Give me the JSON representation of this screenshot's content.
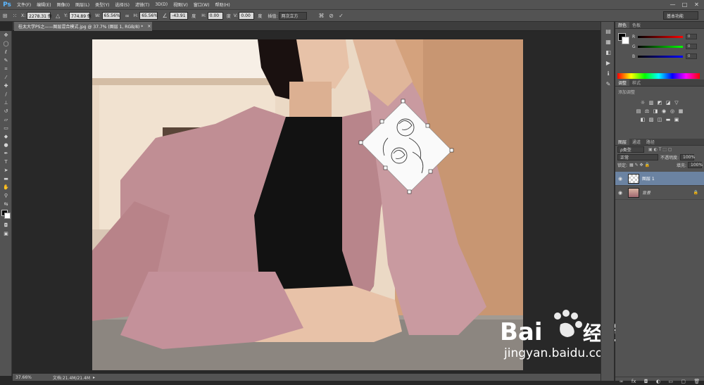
{
  "app": {
    "logo": "Ps"
  },
  "menu": [
    "文件(F)",
    "编辑(E)",
    "图像(I)",
    "图层(L)",
    "类型(Y)",
    "选择(S)",
    "滤镜(T)",
    "3D(D)",
    "视图(V)",
    "窗口(W)",
    "帮助(H)"
  ],
  "window_controls": [
    "—",
    "□",
    "✕"
  ],
  "options": {
    "x_label": "X:",
    "x_value": "2278.31 像",
    "y_label": "Y:",
    "y_value": "774.89 像",
    "w_label": "W:",
    "w_value": "65.56%",
    "h_label": "H:",
    "h_value": "65.56%",
    "angle_value": "-43.91",
    "angle_unit": "度",
    "hskew_label": "H:",
    "hskew_value": "0.00",
    "vskew_label": "V:",
    "vskew_value": "0.00",
    "skew_unit": "度",
    "interp_label": "插值:",
    "interp_value": "两次立方",
    "workspace": "基本功能"
  },
  "document": {
    "tab_title": "桂太大学PS之——图层混合模式.jpg @ 37.7% (图层 1, RGB/8) *",
    "close": "×"
  },
  "status": {
    "zoom": "37.66%",
    "doc_size": "文档:21.4M/21.4M",
    "arrow": "▸"
  },
  "color_panel": {
    "tabs": [
      "颜色",
      "色板"
    ],
    "sliders": [
      {
        "label": "R",
        "value": "0",
        "color": "#ff3b3b"
      },
      {
        "label": "G",
        "value": "0",
        "color": "#3bff3b"
      },
      {
        "label": "B",
        "value": "0",
        "color": "#3b6bff"
      }
    ]
  },
  "adjust_panel": {
    "tabs": [
      "调整",
      "样式"
    ],
    "title": "添加调整"
  },
  "layers_panel": {
    "tabs": [
      "图层",
      "通道",
      "路径"
    ],
    "filter": "ρ类型",
    "blend_mode": "正常",
    "opacity_label": "不透明度:",
    "opacity_value": "100%",
    "lock_label": "锁定:",
    "fill_label": "填充:",
    "fill_value": "100%",
    "layers": [
      {
        "name": "图层 1",
        "selected": true
      },
      {
        "name": "背景",
        "selected": false
      }
    ]
  },
  "watermark": {
    "brand": "Bai",
    "brand2": "经验",
    "url": "jingyan.baidu.com"
  }
}
